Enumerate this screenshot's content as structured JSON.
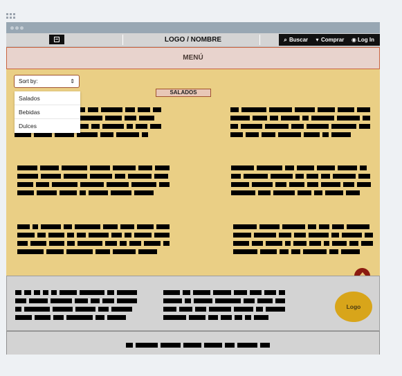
{
  "nav": {
    "logo_text": "LOGO / NOMBRE",
    "buscar": "Buscar",
    "comprar": "Comprar",
    "login": "Log In"
  },
  "menu": {
    "label": "MENÚ"
  },
  "sort": {
    "label": "Sort by:",
    "options": [
      "Salados",
      "Bebidas",
      "Dulces"
    ]
  },
  "section": {
    "title": "SALADOS"
  },
  "footer": {
    "logo_text": "Logo"
  },
  "icons": {
    "menu": "hamburger-icon",
    "search": "search-icon",
    "cart": "cart-icon",
    "login": "user-icon",
    "scroll_top": "arrow-up-icon"
  },
  "colors": {
    "content_bg": "#eacf85",
    "menu_bg": "#e8d3cd",
    "accent": "#c9633f",
    "logo": "#d8a51a",
    "scroll_top": "#8b1a10"
  }
}
